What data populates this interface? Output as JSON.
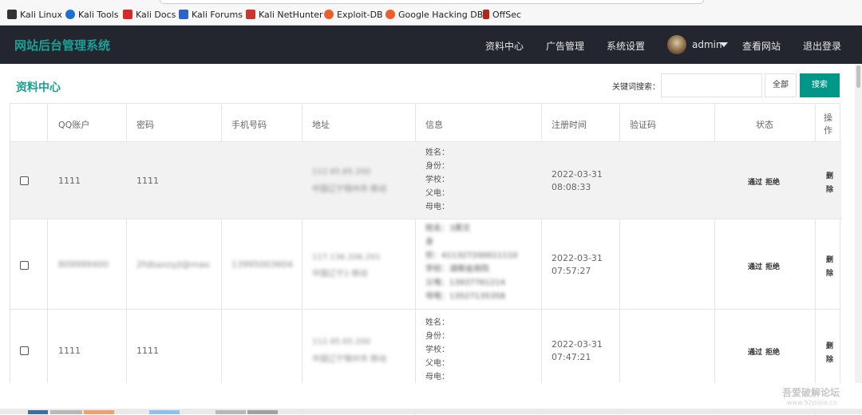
{
  "bookmarks": [
    {
      "label": "Kali Linux",
      "icon": "kali-dragon-icon",
      "color": "#333333"
    },
    {
      "label": "Kali Tools",
      "icon": "kali-tools-icon",
      "color": "#1f6fd1"
    },
    {
      "label": "Kali Docs",
      "icon": "kali-docs-icon",
      "color": "#d42a2a"
    },
    {
      "label": "Kali Forums",
      "icon": "kali-forums-icon",
      "color": "#2f64c7"
    },
    {
      "label": "Kali NetHunter",
      "icon": "kali-nethunter-icon",
      "color": "#c43a32"
    },
    {
      "label": "Exploit-DB",
      "icon": "exploit-db-icon",
      "color": "#e8602c"
    },
    {
      "label": "Google Hacking DB",
      "icon": "ghdb-icon",
      "color": "#e8602c"
    },
    {
      "label": "OffSec",
      "icon": "offsec-icon",
      "color": "#b3261e"
    }
  ],
  "header": {
    "brand": "网站后台管理系统",
    "nav": [
      "资料中心",
      "广告管理",
      "系统设置"
    ],
    "user": "admin",
    "view_site": "查看网站",
    "logout": "退出登录"
  },
  "main": {
    "title": "资料中心",
    "search_label": "关键词搜索：",
    "search_value": "",
    "btn_all": "全部",
    "btn_search": "搜索"
  },
  "table": {
    "headers": [
      "QQ账户",
      "密码",
      "手机号码",
      "地址",
      "信息",
      "注册时间",
      "验证码",
      "状态",
      "操作"
    ],
    "rows": [
      {
        "qq": "1111",
        "pwd": "1111",
        "phone": "",
        "addr1": "112.95.65.200",
        "addr2": "中国辽宁锦州市 移动",
        "info": [
          "姓名：",
          "身份：",
          "学校：",
          "父电：",
          "母电："
        ],
        "date": "2022-03-31",
        "time": "08:08:33",
        "code": "",
        "approve": "通过",
        "reject": "拒绝",
        "del1": "删",
        "del2": "除"
      },
      {
        "qq": "809999400",
        "pwd": "2fdbaxzyjl@mao",
        "phone": "13995003604",
        "addr1": "117.136.206.201",
        "addr2": "中国辽宁2 移动",
        "info": [
          "姓名：3黄文",
          "身",
          "份：411327200011110",
          "学校：湖南省商院",
          "父电：13937761214",
          "母电：13527135358"
        ],
        "date": "2022-03-31",
        "time": "07:57:27",
        "code": "",
        "approve": "通过",
        "reject": "拒绝",
        "del1": "删",
        "del2": "除"
      },
      {
        "qq": "1111",
        "pwd": "1111",
        "phone": "",
        "addr1": "112.95.65.200",
        "addr2": "中国辽宁锦州市 移动",
        "info": [
          "姓名：",
          "身份：",
          "学校：",
          "父电：",
          "母电："
        ],
        "date": "2022-03-31",
        "time": "07:47:21",
        "code": "",
        "approve": "通过",
        "reject": "拒绝",
        "del1": "删",
        "del2": "除"
      }
    ]
  },
  "watermark": {
    "text": "吾爱破解论坛",
    "url": "www.52pojie.cn"
  }
}
